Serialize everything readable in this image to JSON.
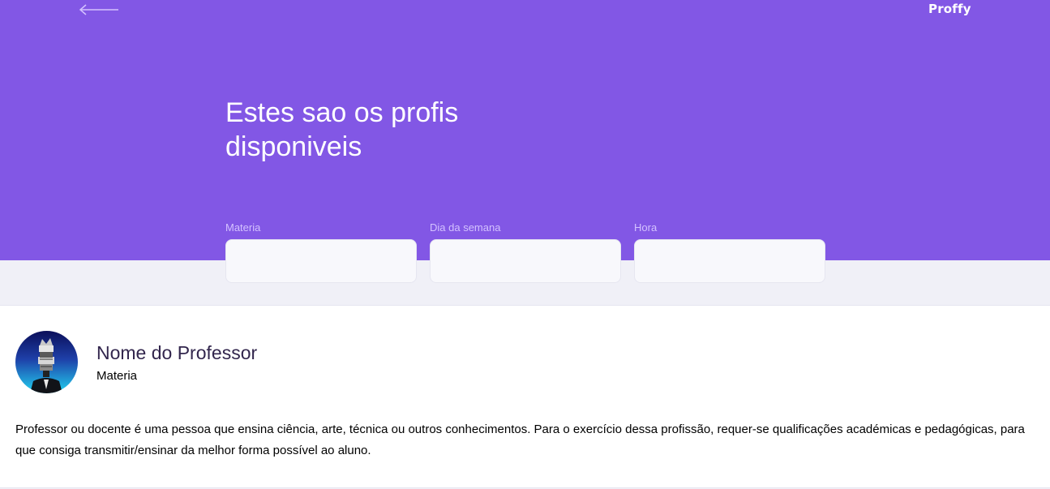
{
  "app": {
    "logo": "Proffy",
    "back_label": "Voltar"
  },
  "header": {
    "title": "Estes sao os profis disponiveis"
  },
  "filters": {
    "subject_label": "Materia",
    "subject_value": "",
    "weekday_label": "Dia da semana",
    "weekday_value": "",
    "time_label": "Hora",
    "time_value": ""
  },
  "teacher": {
    "name": "Nome do Professor",
    "subject": "Materia",
    "bio": "Professor ou docente é uma pessoa que ensina ciência, arte, técnica ou outros conhecimentos. Para o exercício dessa profissão, requer-se qualificações académicas e pedagógicas, para que consiga transmitir/ensinar da melhor forma possível ao aluno."
  },
  "colors": {
    "primary": "#8257E5",
    "background": "#F0F0F7",
    "input_background": "#F8F8FC",
    "label_on_primary": "#D4C2FF",
    "title_text": "#32264D"
  },
  "icons": {
    "back": "arrow-left-icon",
    "avatar": "avatar-image"
  }
}
